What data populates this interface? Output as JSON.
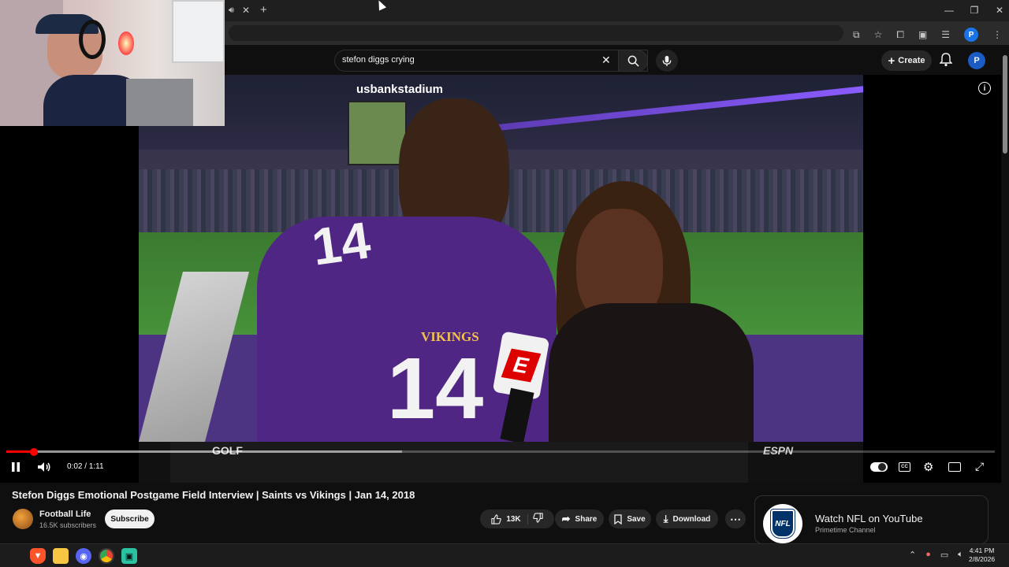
{
  "browser": {
    "tab_icons": [
      "speaker-icon",
      "close-icon",
      "new-tab-plus-icon"
    ],
    "window_controls": [
      "minimize",
      "restore",
      "close"
    ],
    "profile_initial": "P"
  },
  "youtube": {
    "search": {
      "value": "stefon diggs crying"
    },
    "create_label": "Create",
    "avatar_initial": "P"
  },
  "video": {
    "current_time": "0:02",
    "duration": "1:11",
    "time_separator": " / ",
    "progress_fraction": 0.028,
    "buffered_fraction": 0.4,
    "overlay_texts": {
      "stadium": "usbankstadium",
      "jersey": "14",
      "team": "VIKINGS",
      "mic_logo": "E",
      "ticker": "GOLF",
      "network": "ESPN"
    }
  },
  "meta": {
    "title": "Stefon Diggs Emotional Postgame Field Interview | Saints vs Vikings | Jan 14, 2018",
    "channel": "Football Life",
    "subscribers": "16.5K subscribers",
    "subscribe_label": "Subscribe",
    "likes": "13K",
    "share_label": "Share",
    "save_label": "Save",
    "download_label": "Download"
  },
  "promo": {
    "title": "Watch NFL on YouTube",
    "subtitle": "Primetime Channel",
    "logo_text": "NFL"
  },
  "taskbar": {
    "time": "4:41 PM",
    "date": "2/8/2026"
  },
  "colors": {
    "accent_red": "#ff0000",
    "vikings_purple": "#4f2683",
    "bg": "#0f0f0f"
  }
}
